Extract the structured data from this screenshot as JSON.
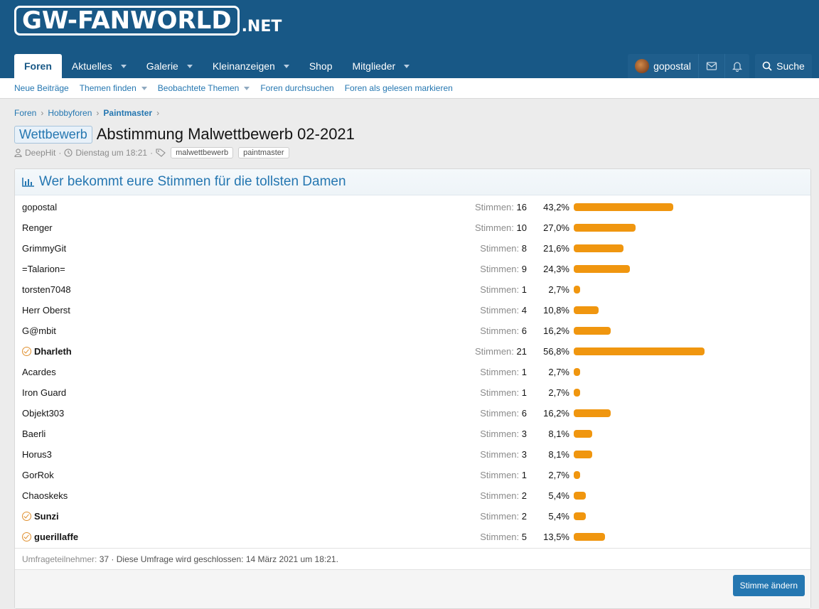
{
  "header": {
    "logo_main": "GW-FANWORLD",
    "logo_suffix": ".NET",
    "nav": [
      {
        "label": "Foren",
        "active": true
      },
      {
        "label": "Aktuelles",
        "dropdown": true
      },
      {
        "label": "Galerie",
        "dropdown": true
      },
      {
        "label": "Kleinanzeigen",
        "dropdown": true
      },
      {
        "label": "Shop"
      },
      {
        "label": "Mitglieder",
        "dropdown": true
      }
    ],
    "username": "gopostal",
    "search_label": "Suche"
  },
  "subnav": [
    "Neue Beiträge",
    "Themen finden",
    "Beobachtete Themen",
    "Foren durchsuchen",
    "Foren als gelesen markieren"
  ],
  "breadcrumbs": [
    "Foren",
    "Hobbyforen",
    "Paintmaster"
  ],
  "thread": {
    "prefix": "Wettbewerb",
    "title": "Abstimmung Malwettbewerb 02-2021",
    "author": "DeepHit",
    "date": "Dienstag um 18:21",
    "tags": [
      "malwettbewerb",
      "paintmaster"
    ]
  },
  "poll": {
    "title": "Wer bekommt eure Stimmen für die tollsten Damen",
    "votes_label": "Stimmen:",
    "bar_color": "#f0960f",
    "rows": [
      {
        "name": "gopostal",
        "votes": "16",
        "pct": "43,2%",
        "fraction": 0.432,
        "voted": false
      },
      {
        "name": "Renger",
        "votes": "10",
        "pct": "27,0%",
        "fraction": 0.27,
        "voted": false
      },
      {
        "name": "GrimmyGit",
        "votes": "8",
        "pct": "21,6%",
        "fraction": 0.216,
        "voted": false
      },
      {
        "name": "=Talarion=",
        "votes": "9",
        "pct": "24,3%",
        "fraction": 0.243,
        "voted": false
      },
      {
        "name": "torsten7048",
        "votes": "1",
        "pct": "2,7%",
        "fraction": 0.027,
        "voted": false
      },
      {
        "name": "Herr Oberst",
        "votes": "4",
        "pct": "10,8%",
        "fraction": 0.108,
        "voted": false
      },
      {
        "name": "G@mbit",
        "votes": "6",
        "pct": "16,2%",
        "fraction": 0.162,
        "voted": false
      },
      {
        "name": "Dharleth",
        "votes": "21",
        "pct": "56,8%",
        "fraction": 0.568,
        "voted": true
      },
      {
        "name": "Acardes",
        "votes": "1",
        "pct": "2,7%",
        "fraction": 0.027,
        "voted": false
      },
      {
        "name": "Iron Guard",
        "votes": "1",
        "pct": "2,7%",
        "fraction": 0.027,
        "voted": false
      },
      {
        "name": "Objekt303",
        "votes": "6",
        "pct": "16,2%",
        "fraction": 0.162,
        "voted": false
      },
      {
        "name": "Baerli",
        "votes": "3",
        "pct": "8,1%",
        "fraction": 0.081,
        "voted": false
      },
      {
        "name": "Horus3",
        "votes": "3",
        "pct": "8,1%",
        "fraction": 0.081,
        "voted": false
      },
      {
        "name": "GorRok",
        "votes": "1",
        "pct": "2,7%",
        "fraction": 0.027,
        "voted": false
      },
      {
        "name": "Chaoskeks",
        "votes": "2",
        "pct": "5,4%",
        "fraction": 0.054,
        "voted": false
      },
      {
        "name": "Sunzi",
        "votes": "2",
        "pct": "5,4%",
        "fraction": 0.054,
        "voted": true
      },
      {
        "name": "guerillaffe",
        "votes": "5",
        "pct": "13,5%",
        "fraction": 0.135,
        "voted": true
      }
    ],
    "footer_label": "Umfrageteilnehmer:",
    "footer_count": "37",
    "footer_text": "· Diese Umfrage wird geschlossen: 14 März 2021 um 18:21.",
    "button_label": "Stimme ändern"
  }
}
